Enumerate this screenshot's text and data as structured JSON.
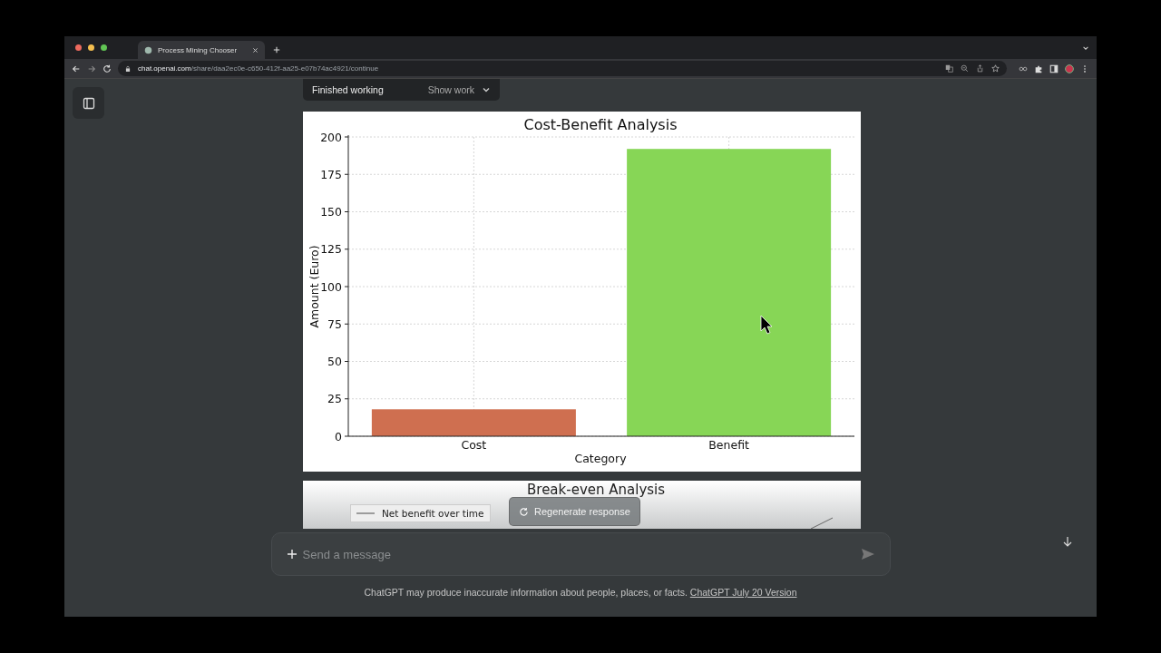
{
  "browser": {
    "tab": {
      "title": "Process Mining Chooser",
      "selected": true
    },
    "address": {
      "domain": "chat.openai.com",
      "path": "/share/daa2ec0e-c650-412f-aa25-e07b74ac4921/continue"
    }
  },
  "work_status": {
    "label": "Finished working",
    "toggle": "Show work"
  },
  "cost_benefit": {
    "bars": [
      {
        "color": "#cf6f50"
      },
      {
        "color": "#87d656"
      }
    ],
    "chart_data": {
      "type": "bar",
      "title": "Cost-Benefit Analysis",
      "xlabel": "Category",
      "ylabel": "Amount (Euro)",
      "categories": [
        "Cost",
        "Benefit"
      ],
      "values": [
        18,
        192
      ],
      "ylim": [
        0,
        200
      ],
      "yticks": [
        0,
        25,
        50,
        75,
        100,
        125,
        150,
        175,
        200
      ],
      "grid": true
    }
  },
  "break_even": {
    "title": "Break-even Analysis",
    "legend": "Net benefit over time"
  },
  "regenerate_button": "Regenerate response",
  "composer": {
    "placeholder": "Send a message"
  },
  "footer": {
    "text": "ChatGPT may produce inaccurate information about people, places, or facts.",
    "link": "ChatGPT July 20 Version"
  }
}
